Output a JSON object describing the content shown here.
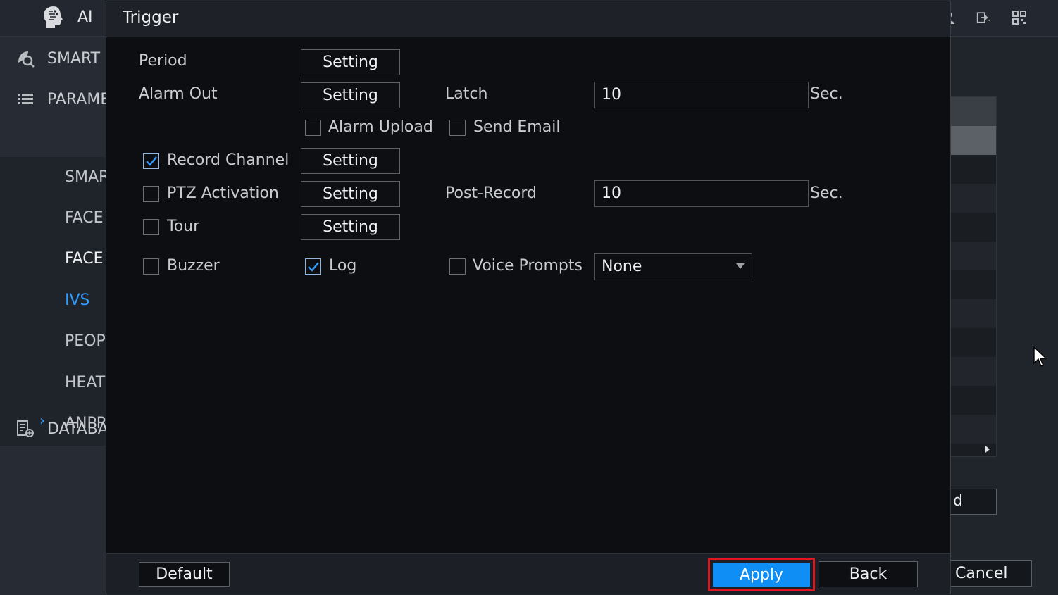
{
  "app": {
    "title": "AI"
  },
  "sidebar": {
    "groups": [
      {
        "label": "SMART"
      },
      {
        "label": "PARAMETERS"
      },
      {
        "label": "DATABASE"
      }
    ],
    "sub_items": [
      {
        "label": "SMART"
      },
      {
        "label": "FACE"
      },
      {
        "label": "FACE"
      },
      {
        "label": "IVS"
      },
      {
        "label": "PEOPLE"
      },
      {
        "label": "HEAT"
      },
      {
        "label": "ANPR"
      }
    ],
    "active_arrow": "›"
  },
  "background": {
    "input_value": "d",
    "cancel_label": "Cancel"
  },
  "dialog": {
    "title": "Trigger",
    "period_label": "Period",
    "alarm_out_label": "Alarm Out",
    "setting_label": "Setting",
    "latch_label": "Latch",
    "latch_value": "10",
    "sec_label": "Sec.",
    "alarm_upload_label": "Alarm Upload",
    "send_email_label": "Send Email",
    "record_channel_label": "Record Channel",
    "ptz_activation_label": "PTZ Activation",
    "post_record_label": "Post-Record",
    "post_record_value": "10",
    "tour_label": "Tour",
    "buzzer_label": "Buzzer",
    "log_label": "Log",
    "voice_prompts_label": "Voice Prompts",
    "voice_prompts_value": "None",
    "checks": {
      "alarm_upload": false,
      "send_email": false,
      "record_channel": true,
      "ptz_activation": false,
      "tour": false,
      "buzzer": false,
      "log": true,
      "voice_prompts": false
    }
  },
  "footer": {
    "default_label": "Default",
    "apply_label": "Apply",
    "back_label": "Back"
  },
  "colors": {
    "accent": "#0f8ff5",
    "highlight_border": "#e0161e",
    "active_nav": "#2f9bff"
  }
}
